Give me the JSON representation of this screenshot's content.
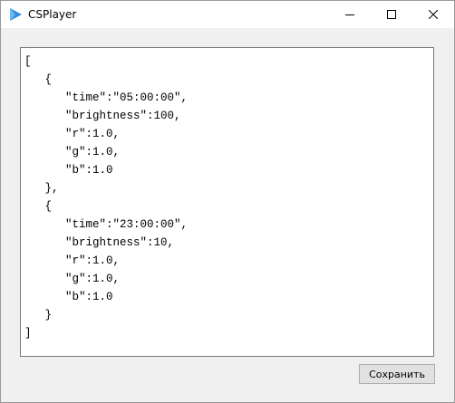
{
  "window": {
    "title": "CSPlayer",
    "icon": "play-triangle-icon"
  },
  "controls": {
    "minimize_icon": "minimize-icon",
    "maximize_icon": "maximize-icon",
    "close_icon": "close-icon"
  },
  "editor": {
    "content": "[\n   {\n      \"time\":\"05:00:00\",\n      \"brightness\":100,\n      \"r\":1.0,\n      \"g\":1.0,\n      \"b\":1.0\n   },\n   {\n      \"time\":\"23:00:00\",\n      \"brightness\":10,\n      \"r\":1.0,\n      \"g\":1.0,\n      \"b\":1.0\n   }\n]"
  },
  "actions": {
    "save_label": "Сохранить"
  },
  "colors": {
    "icon_blue": "#2b8ee0",
    "window_bg": "#f0f0f0"
  }
}
